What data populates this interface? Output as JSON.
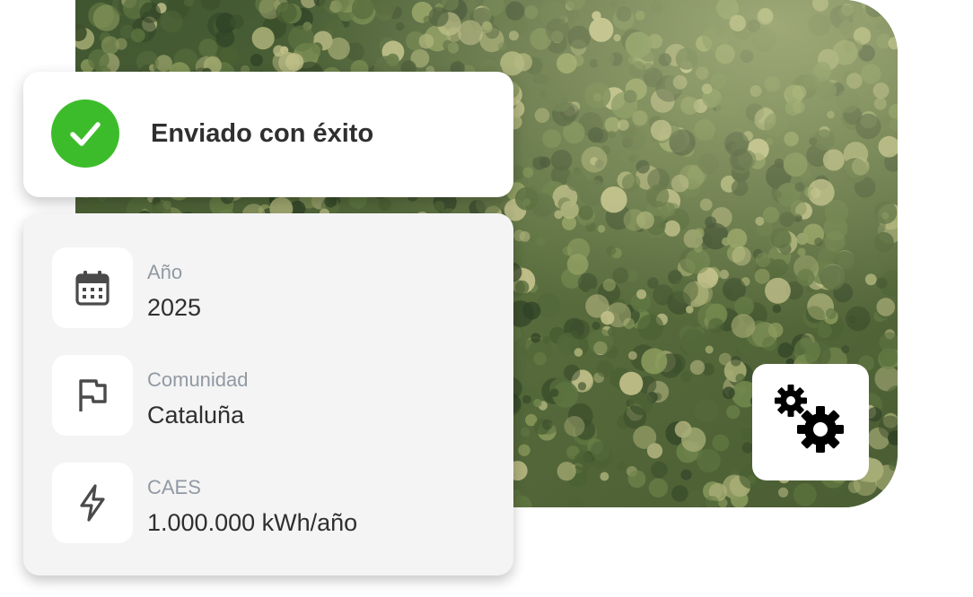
{
  "notification": {
    "message": "Enviado con éxito",
    "icon": "check-icon",
    "accent_color": "#3dbc2b"
  },
  "details": [
    {
      "label": "Año",
      "value": "2025",
      "icon": "calendar-icon"
    },
    {
      "label": "Comunidad",
      "value": "Cataluña",
      "icon": "flag-icon"
    },
    {
      "label": "CAES",
      "value": "1.000.000 kWh/año",
      "icon": "lightning-icon"
    }
  ],
  "settings_button": {
    "icon": "gears-icon"
  },
  "colors": {
    "label": "#9199a3",
    "text": "#2f2f2f",
    "panel_bg": "#f4f4f4"
  }
}
